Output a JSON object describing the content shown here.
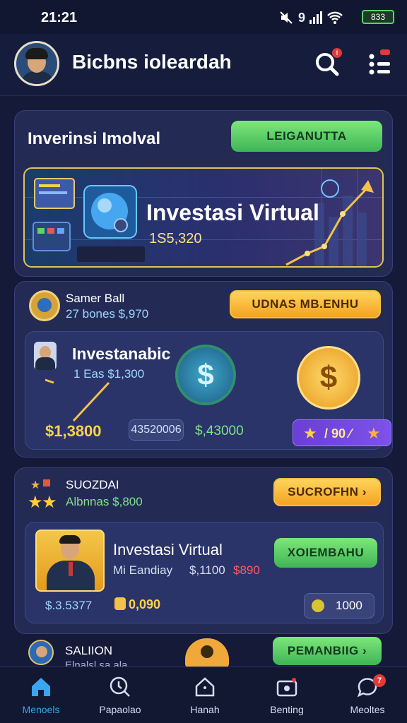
{
  "status": {
    "time": "21:21",
    "signal_text": "9",
    "battery": "833"
  },
  "header": {
    "app_name": "Bicbns ioleardah",
    "search_badge": "!",
    "menu_badge": "!"
  },
  "hero": {
    "title": "Inverinsi Imolval",
    "action_label": "LEIGANUTTA",
    "banner": {
      "title": "Investasi Virtual",
      "amount": "1S5,320"
    }
  },
  "card2": {
    "user_name": "Samer Ball",
    "user_sub": "27 bones $,970",
    "action_label": "UDNAS MB.ENHU",
    "inner": {
      "title": "Investanabic",
      "subtitle": "1 Eas  $1,300",
      "value_left": "$1,3800",
      "value_mid": "43520006",
      "value_right": "$,43000",
      "rating_text": "/ 90 ⁄"
    }
  },
  "card3": {
    "title": "SUOZDAI",
    "subtitle": "Albnnas $,800",
    "action_label": "SUCROFHN",
    "inner": {
      "title": "Investasi Virtual",
      "subtitle": "Mi Eandiay",
      "price": "$,1100",
      "price_red": "$890",
      "value_left": "$.3.5377",
      "value_mid": "0,090",
      "action_label": "XOIEMBAHU",
      "count": "1000"
    }
  },
  "card4": {
    "title": "SALIION",
    "subtitle": "Elnalsl sa ala",
    "action_label": "PEMANBIIG"
  },
  "bottomnav": {
    "items": [
      {
        "label": "Menoels",
        "active": true
      },
      {
        "label": "Papaolao",
        "active": false
      },
      {
        "label": "Hanah",
        "active": false
      },
      {
        "label": "Benting",
        "active": false
      },
      {
        "label": "Meoltes",
        "active": false,
        "badge": "7"
      }
    ]
  },
  "colors": {
    "accent_green": "#4fc35c",
    "accent_orange": "#f6b533",
    "nav_active": "#3aa5f0",
    "background": "#141a38"
  }
}
